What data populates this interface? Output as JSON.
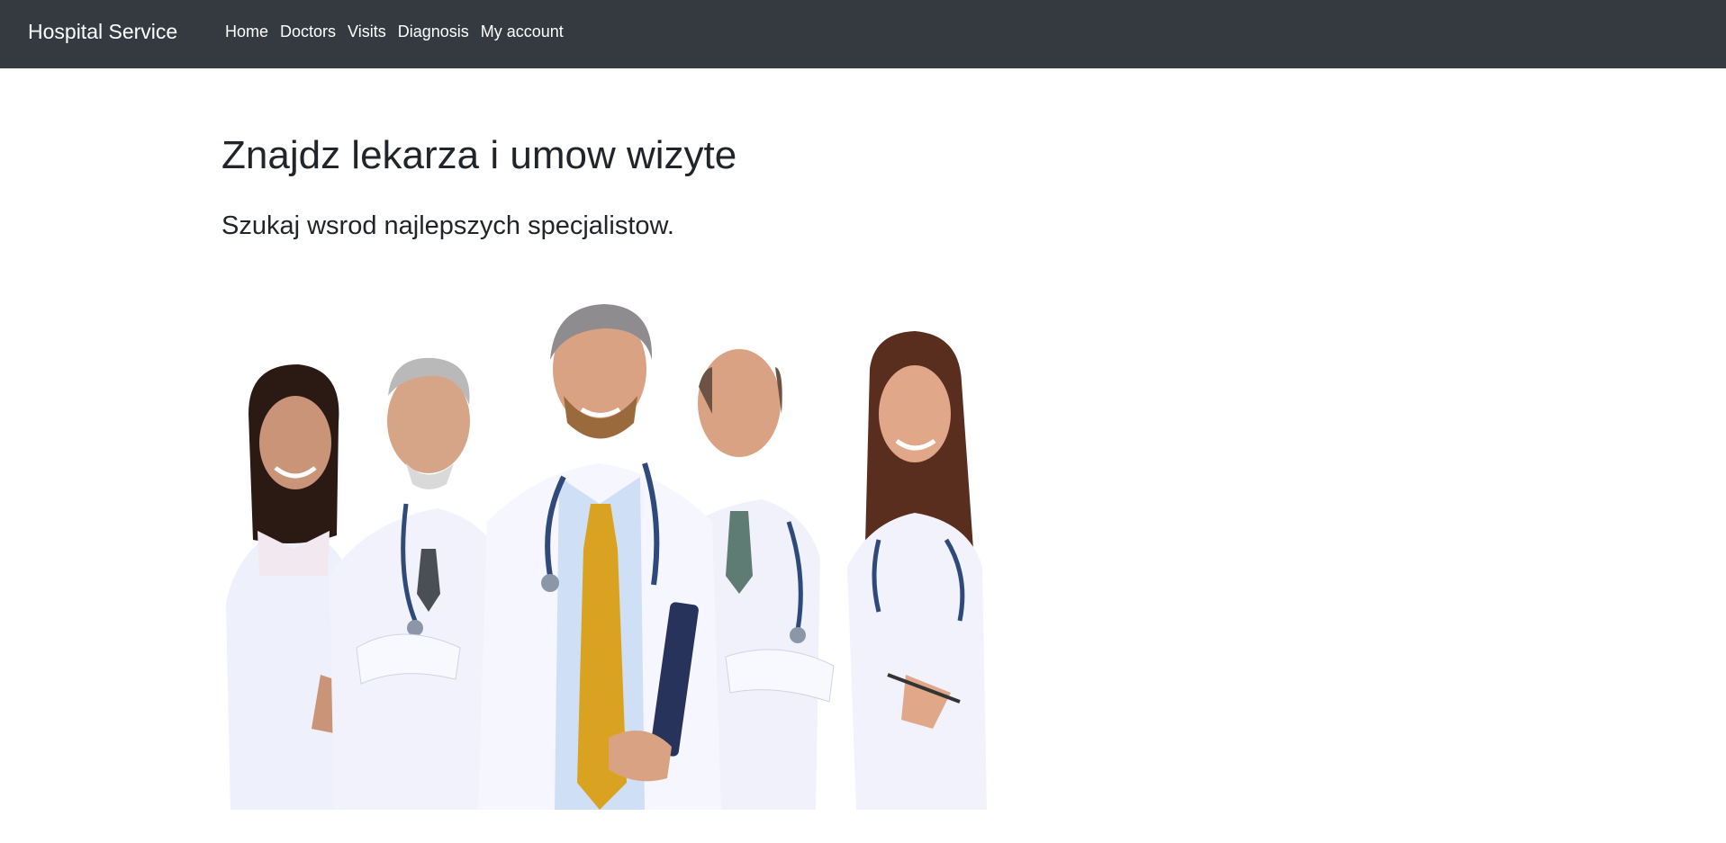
{
  "navbar": {
    "brand": "Hospital Service",
    "links": [
      "Home",
      "Doctors",
      "Visits",
      "Diagnosis",
      "My account"
    ],
    "background": "#343a40"
  },
  "hero": {
    "title": "Znajdz lekarza i umow wizyte",
    "subtitle": "Szukaj wsrod najlepszych specjalistow."
  }
}
